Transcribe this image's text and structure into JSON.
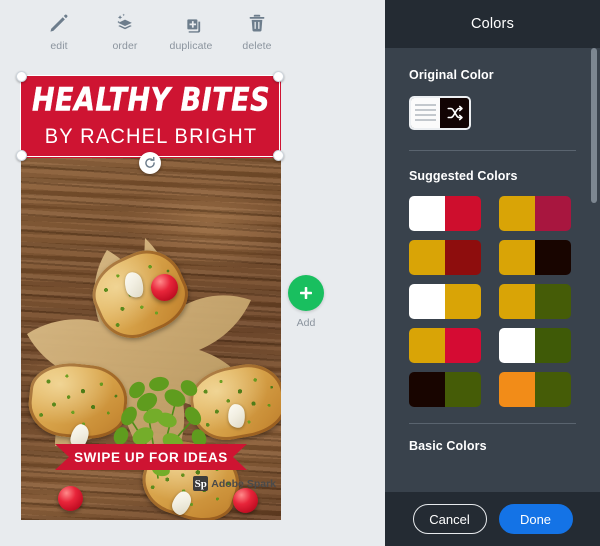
{
  "toolbar": {
    "items": [
      {
        "label": "edit",
        "icon": "pencil-icon"
      },
      {
        "label": "order",
        "icon": "layers-icon"
      },
      {
        "label": "duplicate",
        "icon": "duplicate-icon"
      },
      {
        "label": "delete",
        "icon": "trash-icon"
      }
    ]
  },
  "poster": {
    "title_main": "HEALTHY BITES",
    "title_sub": "BY RACHEL BRIGHT",
    "ribbon_text": "SWIPE UP FOR IDEAS",
    "watermark_mark": "Sp",
    "watermark_text": "Adobe Spark",
    "band_color": "#ce1432",
    "ribbon_color": "#ce1432"
  },
  "add": {
    "label": "Add",
    "icon": "plus-icon",
    "color": "#19bf5f"
  },
  "panel": {
    "title": "Colors",
    "original_label": "Original Color",
    "original_swatch": {
      "left_color": "#fbfbfb",
      "right_color": "#120403",
      "icon": "shuffle-icon"
    },
    "suggested_label": "Suggested Colors",
    "basic_label": "Basic Colors",
    "suggested_colors": [
      {
        "left": "#ffffff",
        "right": "#ce0e2d"
      },
      {
        "left": "#d9a406",
        "right": "#a8163f"
      },
      {
        "left": "#d9a406",
        "right": "#8e0d0d"
      },
      {
        "left": "#d9a406",
        "right": "#180500"
      },
      {
        "left": "#ffffff",
        "right": "#d9a406"
      },
      {
        "left": "#d9a406",
        "right": "#455c07"
      },
      {
        "left": "#d9a406",
        "right": "#d50b33"
      },
      {
        "left": "#ffffff",
        "right": "#3f5a07"
      },
      {
        "left": "#180500",
        "right": "#455c07"
      },
      {
        "left": "#f28c18",
        "right": "#455c07"
      }
    ],
    "cancel_label": "Cancel",
    "done_label": "Done",
    "done_color": "#1473e6",
    "header_bg": "#242b33",
    "body_bg": "#39424c"
  }
}
